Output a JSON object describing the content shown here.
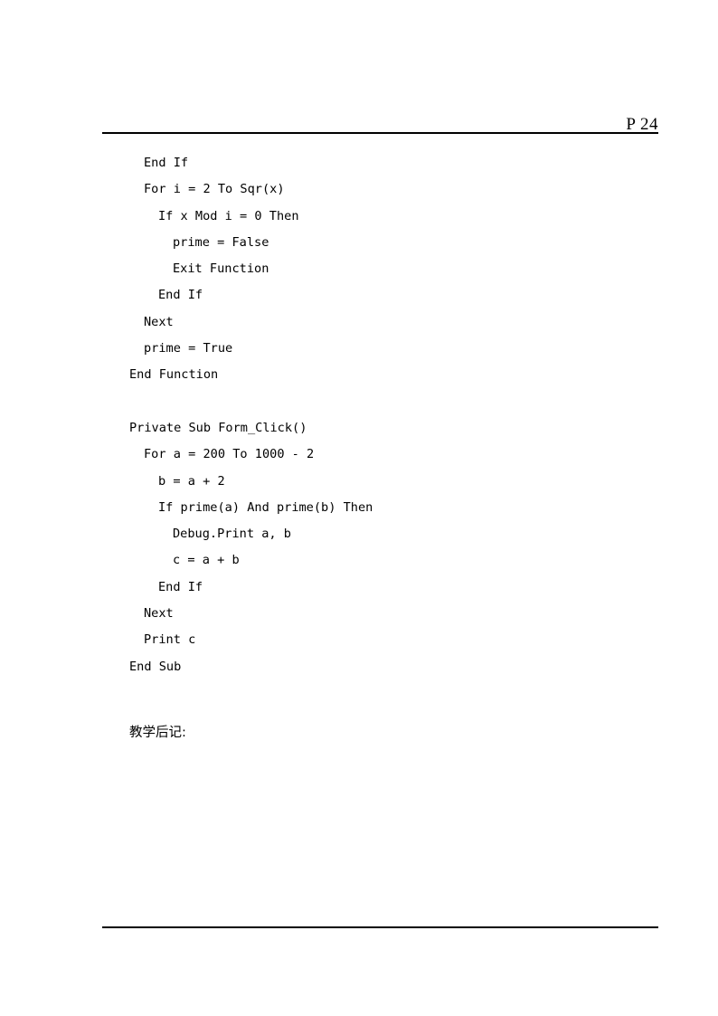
{
  "page": {
    "background_color": "#ffffff",
    "text_color": "#000000"
  },
  "header": {
    "page_number": "P 24"
  },
  "code": {
    "lines": [
      {
        "indent": 1,
        "text": "End If"
      },
      {
        "indent": 1,
        "text": "For i = 2 To Sqr(x)"
      },
      {
        "indent": 2,
        "text": "If x Mod i = 0 Then"
      },
      {
        "indent": 3,
        "text": "prime = False"
      },
      {
        "indent": 3,
        "text": "Exit Function"
      },
      {
        "indent": 2,
        "text": "End If"
      },
      {
        "indent": 1,
        "text": "Next"
      },
      {
        "indent": 1,
        "text": "prime = True"
      },
      {
        "indent": 0,
        "text": "End Function"
      },
      {
        "indent": 0,
        "text": ""
      },
      {
        "indent": 0,
        "text": "Private Sub Form_Click()"
      },
      {
        "indent": 1,
        "text": "For a = 200 To 1000 - 2"
      },
      {
        "indent": 2,
        "text": "b = a + 2"
      },
      {
        "indent": 2,
        "text": "If prime(a) And prime(b) Then"
      },
      {
        "indent": 3,
        "text": "Debug.Print a, b"
      },
      {
        "indent": 3,
        "text": "c = a + b"
      },
      {
        "indent": 2,
        "text": "End If"
      },
      {
        "indent": 1,
        "text": "Next"
      },
      {
        "indent": 1,
        "text": "Print c"
      },
      {
        "indent": 0,
        "text": "End Sub"
      }
    ]
  },
  "notes": {
    "heading": "教学后记:"
  }
}
